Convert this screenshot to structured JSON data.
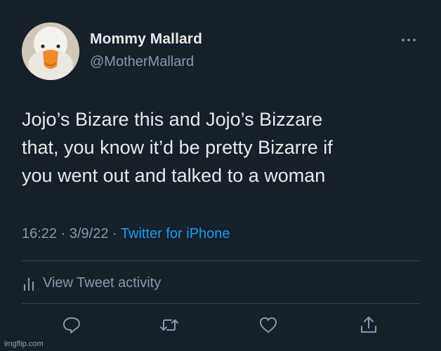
{
  "tweet": {
    "display_name": "Mommy Mallard",
    "handle": "@MotherMallard",
    "text_lines": [
      "Jojo’s Bizare this and Jojo’s Bizzare",
      "that, you know it’d be pretty Bizarre if",
      "you went out and talked to a woman"
    ],
    "time": "16:22",
    "date": "3/9/22",
    "separator": "·",
    "source": "Twitter for iPhone",
    "activity_label": "View Tweet activity"
  },
  "icons": {
    "more": "more-horizontal-icon",
    "activity": "bar-chart-icon",
    "reply": "reply-icon",
    "retweet": "retweet-icon",
    "like": "heart-icon",
    "share": "share-icon"
  },
  "colors": {
    "background": "#15202b",
    "text": "#e7e9ea",
    "secondary": "#8b98a5",
    "link": "#1d9bf0",
    "divider": "#38444d"
  },
  "watermark": "imgflip.com"
}
